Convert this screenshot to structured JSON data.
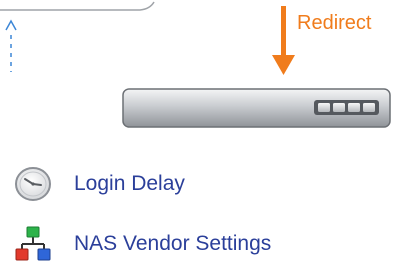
{
  "diagram": {
    "redirect_label": "Redirect"
  },
  "menu": {
    "items": [
      {
        "label": "Login Delay",
        "icon": "clock-icon"
      },
      {
        "label": "NAS Vendor Settings",
        "icon": "network-nodes-icon"
      }
    ]
  },
  "colors": {
    "accent_orange": "#f07c1c",
    "link_blue": "#2b3f9a",
    "connector_blue": "#3c86d6",
    "device_gray": "#bfc2c6"
  }
}
